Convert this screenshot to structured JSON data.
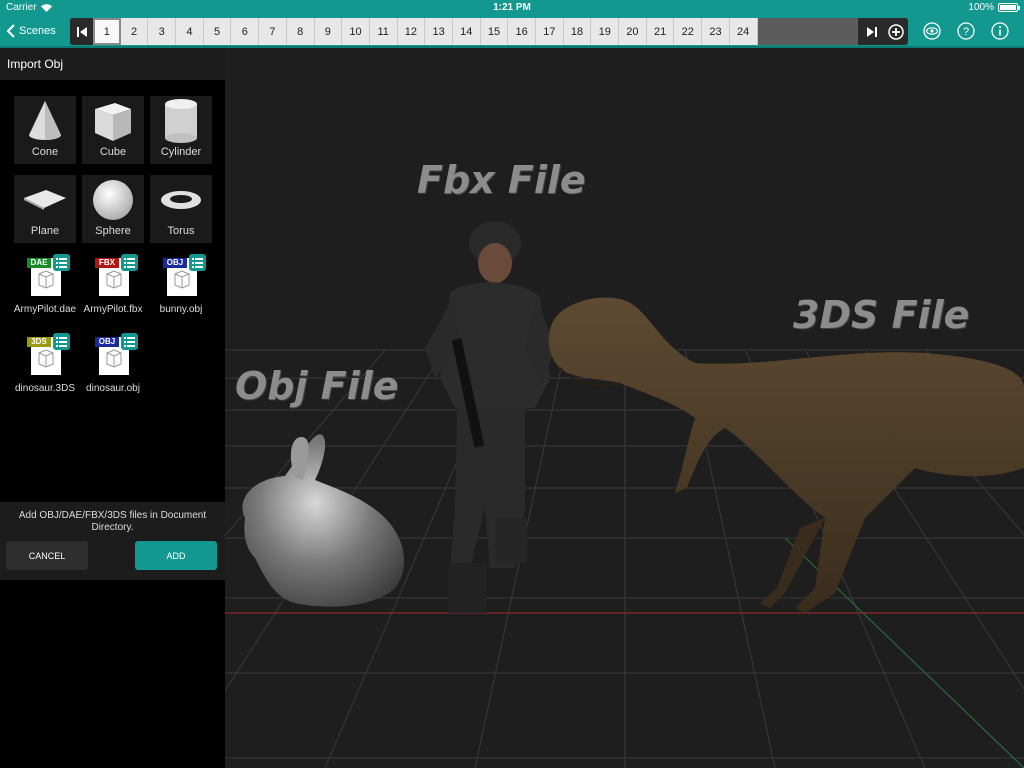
{
  "status": {
    "carrier": "Carrier",
    "time": "1:21 PM",
    "battery": "100%",
    "battery_level": 1.0
  },
  "nav": {
    "back_label": "Scenes"
  },
  "frames": [
    "1",
    "2",
    "3",
    "4",
    "5",
    "6",
    "7",
    "8",
    "9",
    "10",
    "11",
    "12",
    "13",
    "14",
    "15",
    "16",
    "17",
    "18",
    "19",
    "20",
    "21",
    "22",
    "23",
    "24"
  ],
  "active_frame": "1",
  "panel": {
    "title": "Import Obj",
    "primitives": [
      "Cone",
      "Cube",
      "Cylinder",
      "Plane",
      "Sphere",
      "Torus"
    ],
    "files": [
      {
        "name": "ArmyPilot.dae",
        "type": "DAE",
        "color": "#1a8a2a"
      },
      {
        "name": "ArmyPilot.fbx",
        "type": "FBX",
        "color": "#b01818"
      },
      {
        "name": "bunny.obj",
        "type": "OBJ",
        "color": "#1a2a9a"
      },
      {
        "name": "dinosaur.3DS",
        "type": "3DS",
        "color": "#9a9a10"
      },
      {
        "name": "dinosaur.obj",
        "type": "OBJ",
        "color": "#1a2a9a"
      }
    ],
    "hint": "Add OBJ/DAE/FBX/3DS files in Document Directory.",
    "cancel_label": "CANCEL",
    "add_label": "ADD"
  },
  "scene": {
    "labels": {
      "fbx": "Fbx File",
      "three_ds": "3DS File",
      "obj": "Obj File"
    }
  },
  "colors": {
    "accent": "#12988f",
    "panel": "#000000",
    "viewport": "#1e1e1e"
  }
}
